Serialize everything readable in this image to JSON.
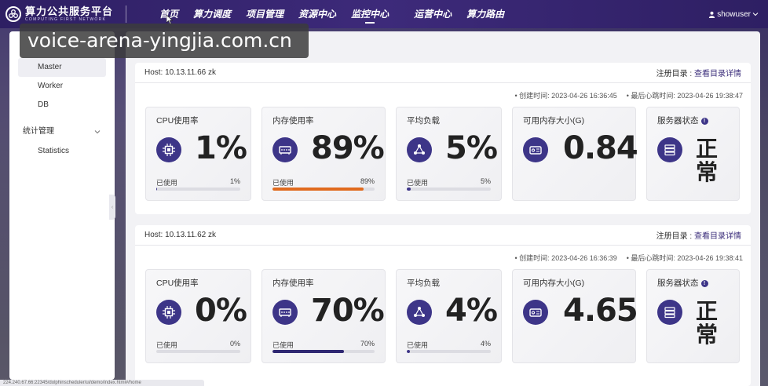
{
  "app": {
    "logo_cn": "算力公共服务平台",
    "logo_en": "COMPUTING FIRST NETWORK"
  },
  "nav": {
    "items": [
      {
        "label": "首页"
      },
      {
        "label": "算力调度"
      },
      {
        "label": "项目管理"
      },
      {
        "label": "资源中心"
      },
      {
        "label": "监控中心"
      },
      {
        "label": "运营中心"
      },
      {
        "label": "算力路由"
      }
    ],
    "active": "监控中心"
  },
  "user": {
    "name": "showuser"
  },
  "overlay": {
    "text": "voice-arena-yingjia.com.cn"
  },
  "sidebar": {
    "items": [
      {
        "label": "Master"
      },
      {
        "label": "Worker"
      },
      {
        "label": "DB"
      }
    ],
    "group": {
      "label": "统计管理"
    },
    "group_items": [
      {
        "label": "Statistics"
      }
    ],
    "collapse_glyph": "‹"
  },
  "hosts": [
    {
      "host_label": "Host: 10.13.11.66   zk",
      "dir_label": "注册目录 : ",
      "dir_link": "查看目录详情",
      "created": "• 创建时间: 2023-04-26 16:36:45",
      "heartbeat": "• 最后心跳时间: 2023-04-26 19:38:47",
      "cpu": {
        "title": "CPU使用率",
        "value": "1%",
        "used_label": "已使用",
        "pct": "1%",
        "fill": 0.01
      },
      "mem": {
        "title": "内存使用率",
        "value": "89%",
        "used_label": "已使用",
        "pct": "89%",
        "fill": 0.89
      },
      "load": {
        "title": "平均负载",
        "value": "5%",
        "used_label": "已使用",
        "pct": "5%",
        "fill": 0.05
      },
      "avail": {
        "title": "可用内存大小(G)",
        "value": "0.84"
      },
      "status": {
        "title": "服务器状态",
        "value": "正常",
        "info": "!"
      }
    },
    {
      "host_label": "Host: 10.13.11.62   zk",
      "dir_label": "注册目录 : ",
      "dir_link": "查看目录详情",
      "created": "• 创建时间: 2023-04-26 16:36:39",
      "heartbeat": "• 最后心跳时间: 2023-04-26 19:38:41",
      "cpu": {
        "title": "CPU使用率",
        "value": "0%",
        "used_label": "已使用",
        "pct": "0%",
        "fill": 0.0
      },
      "mem": {
        "title": "内存使用率",
        "value": "70%",
        "used_label": "已使用",
        "pct": "70%",
        "fill": 0.7
      },
      "load": {
        "title": "平均负载",
        "value": "4%",
        "used_label": "已使用",
        "pct": "4%",
        "fill": 0.04
      },
      "avail": {
        "title": "可用内存大小(G)",
        "value": "4.65"
      },
      "status": {
        "title": "服务器状态",
        "value": "正常",
        "info": "!"
      }
    }
  ],
  "colors": {
    "accent": "#3d3588",
    "mem_bar_host1": "#e06a1e",
    "mem_bar_host2": "#2f2872",
    "header_bg": "#2e1f63"
  },
  "statusbar": {
    "text": "224.240.67.66:22345/dolphinscheduler/ui/demo/index.html#/home"
  }
}
